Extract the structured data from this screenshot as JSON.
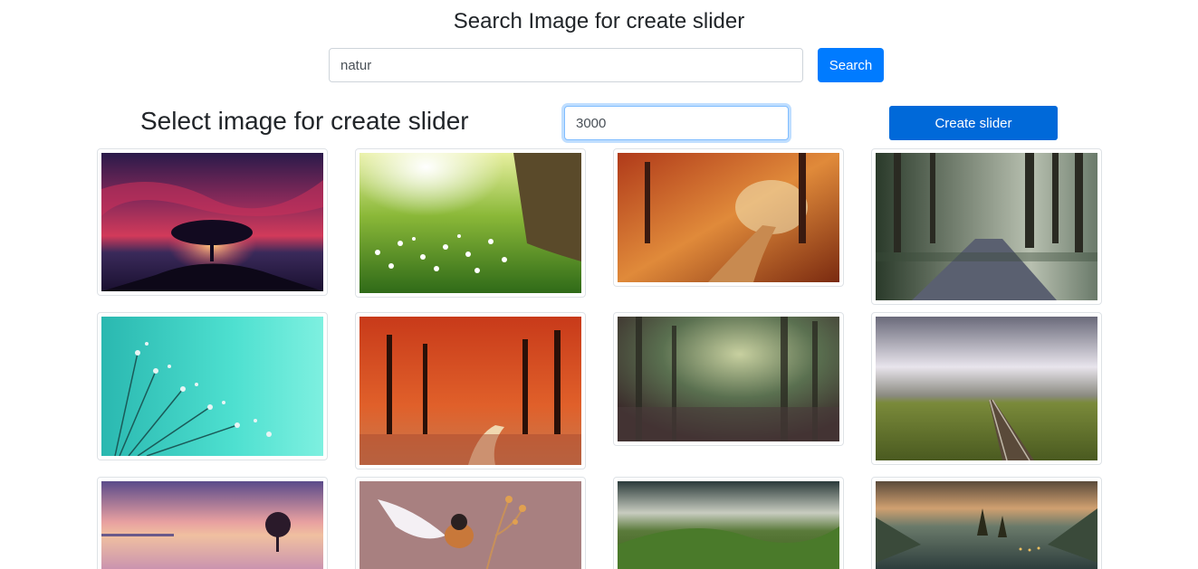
{
  "search": {
    "title": "Search Image for create slider",
    "query": "natur",
    "button_label": "Search"
  },
  "slider": {
    "title": "Select image for create slider",
    "duration_value": "3000",
    "create_button_label": "Create slider"
  },
  "images": [
    {
      "name": "image-tree-sunset",
      "subject": "lone tree at crimson sunset"
    },
    {
      "name": "image-daisy-meadow",
      "subject": "sunlit daisy meadow"
    },
    {
      "name": "image-autumn-path",
      "subject": "autumn forest path"
    },
    {
      "name": "image-forest-road",
      "subject": "misty forest road"
    },
    {
      "name": "image-dandelion-dew",
      "subject": "dandelion with dew drops"
    },
    {
      "name": "image-red-forest",
      "subject": "red autumn forest"
    },
    {
      "name": "image-foggy-forest",
      "subject": "foggy green forest"
    },
    {
      "name": "image-railway-field",
      "subject": "railway through a field"
    },
    {
      "name": "image-lake-tree",
      "subject": "tree in a lake at dusk"
    },
    {
      "name": "image-bird-flight",
      "subject": "bird in flight"
    },
    {
      "name": "image-green-valley",
      "subject": "green valley under clouds"
    },
    {
      "name": "image-mountain-lake",
      "subject": "mountain lake with pines"
    }
  ]
}
